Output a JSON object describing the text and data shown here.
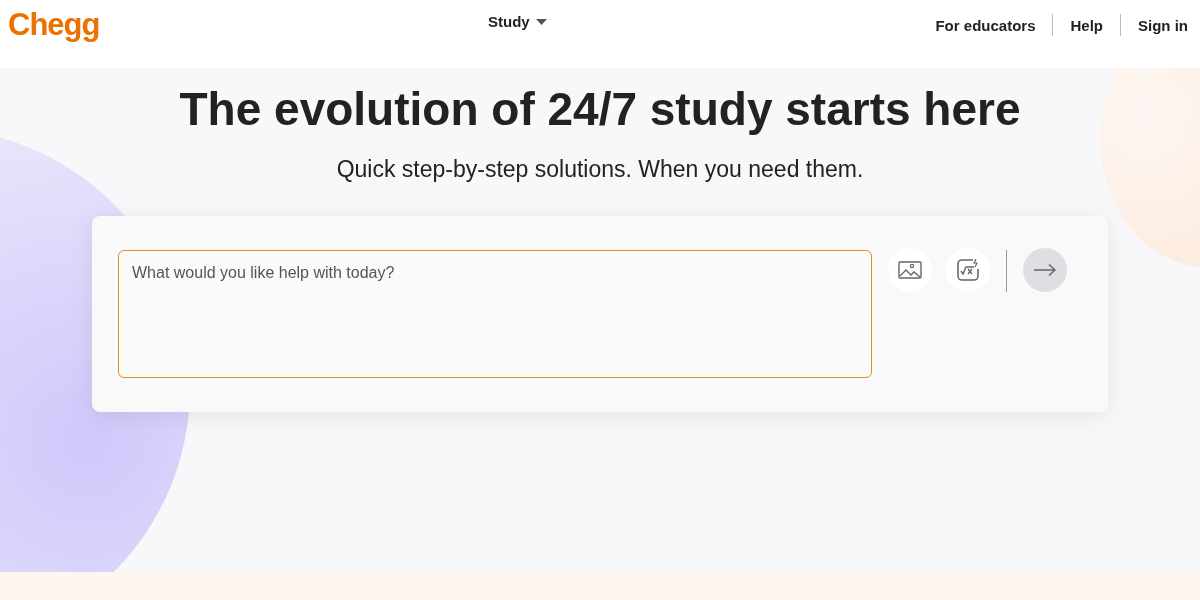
{
  "header": {
    "logo": "Chegg",
    "nav_menu": {
      "label": "Study"
    },
    "links": [
      "For educators",
      "Help",
      "Sign in"
    ]
  },
  "hero": {
    "title": "The evolution of 24/7 study starts here",
    "subtitle": "Quick step-by-step solutions. When you need them."
  },
  "question_box": {
    "placeholder": "What would you like help with today?"
  }
}
